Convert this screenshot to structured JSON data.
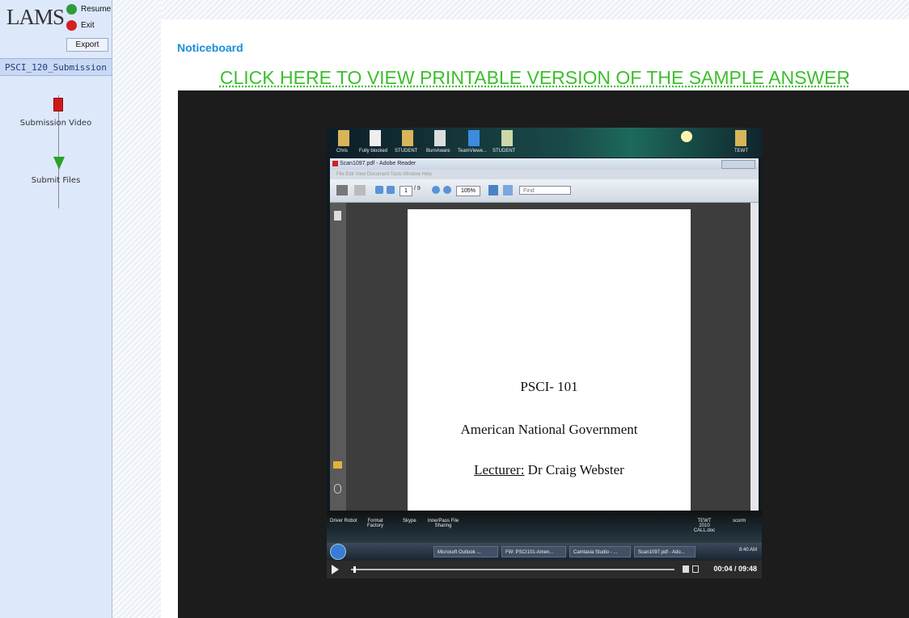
{
  "sidebar": {
    "logo": "LAMS",
    "resume_label": "Resume",
    "exit_label": "Exit",
    "export_label": "Export",
    "sequence_title": "PSCI_120_Submission ...",
    "activities": [
      {
        "label": "Submission Video",
        "color": "#d01717"
      },
      {
        "label": "Submit Files",
        "color": "#27a327"
      }
    ]
  },
  "main": {
    "title": "Noticeboard",
    "sample_link": "CLICK HERE TO VIEW PRINTABLE VERSION OF THE SAMPLE ANSWER"
  },
  "video": {
    "desktop_icons": [
      "Chris",
      "Fully blocked",
      "STUDENT",
      "BurnAware",
      "TeamViewe...",
      "STUDENT",
      "TEWT"
    ],
    "reader": {
      "title": "Scan1097.pdf - Adobe Reader",
      "menu": "File  Edit  View  Document  Tools  Window  Help",
      "page_field": "1",
      "page_total": "/ 9",
      "zoom": "105%",
      "find": "Find",
      "page_lines": [
        "PSCI- 101",
        "American National Government",
        "Lecturer:",
        "Dr Craig Webster"
      ]
    },
    "bottom_icons": [
      "Driver Robot",
      "Format Factory",
      "Skype",
      "InnerPass File Sharing",
      "TEWT 2010 CALL.doc",
      "scorm"
    ],
    "taskbar": [
      "Microsoft Outlook ...",
      "FW: PSCI101-Amen...",
      "Camtasia Studio - ...",
      "Scan1097.pdf - Ado..."
    ],
    "clock": "8:40 AM",
    "time": "00:04 / 09:48",
    "progress": 0.007
  }
}
